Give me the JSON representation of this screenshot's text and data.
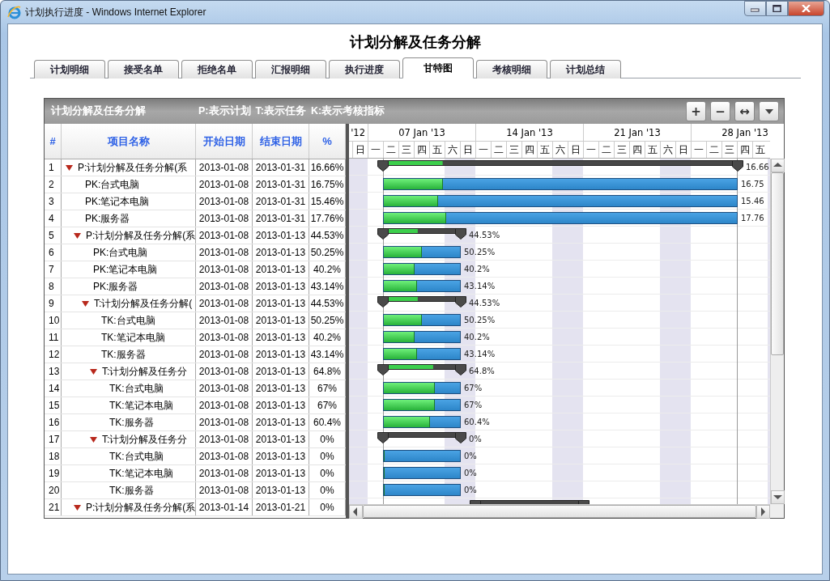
{
  "window": {
    "title": "计划执行进度 - Windows Internet Explorer"
  },
  "page_title": "计划分解及任务分解",
  "tabs": [
    {
      "label": "计划明细",
      "selected": false
    },
    {
      "label": "接受名单",
      "selected": false
    },
    {
      "label": "拒绝名单",
      "selected": false
    },
    {
      "label": "汇报明细",
      "selected": false
    },
    {
      "label": "执行进度",
      "selected": false
    },
    {
      "label": "甘特图",
      "selected": true
    },
    {
      "label": "考核明细",
      "selected": false
    },
    {
      "label": "计划总结",
      "selected": false
    }
  ],
  "panel": {
    "title": "计划分解及任务分解",
    "legend": [
      "P:表示计划",
      "T:表示任务",
      "K:表示考核指标"
    ],
    "toolbar_buttons": [
      "+",
      "−",
      "↔"
    ]
  },
  "columns": [
    "#",
    "项目名称",
    "开始日期",
    "结束日期",
    "%"
  ],
  "timeline": {
    "weeks": [
      "'12",
      "07 Jan '13",
      "14 Jan '13",
      "21 Jan '13",
      "28 Jan '13"
    ],
    "days": [
      "日",
      "一",
      "二",
      "三",
      "四",
      "五",
      "六",
      "日",
      "一",
      "二",
      "三",
      "四",
      "五",
      "六",
      "日",
      "一",
      "二",
      "三",
      "四",
      "五",
      "六",
      "日",
      "一",
      "二",
      "三",
      "四",
      "五"
    ]
  },
  "rows": [
    {
      "num": "1",
      "name": "P:计划分解及任务分解(系",
      "start": "2013-01-08",
      "end": "2013-01-31",
      "percent": "16.66%",
      "expanded": true,
      "bar": {
        "kind": "summary",
        "level": 0.1666,
        "label": "16.66"
      },
      "children": [
        {
          "num": "2",
          "name": "PK:台式电脑",
          "start": "2013-01-08",
          "end": "2013-01-31",
          "percent": "16.75%",
          "bar": {
            "kind": "task",
            "level": 0.1675,
            "label": "16.75"
          }
        },
        {
          "num": "3",
          "name": "PK:笔记本电脑",
          "start": "2013-01-08",
          "end": "2013-01-31",
          "percent": "15.46%",
          "bar": {
            "kind": "task",
            "level": 0.1546,
            "label": "15.46"
          }
        },
        {
          "num": "4",
          "name": "PK:服务器",
          "start": "2013-01-08",
          "end": "2013-01-31",
          "percent": "17.76%",
          "bar": {
            "kind": "task",
            "level": 0.1776,
            "label": "17.76"
          }
        },
        {
          "num": "5",
          "name": "P:计划分解及任务分解(系",
          "start": "2013-01-08",
          "end": "2013-01-13",
          "percent": "44.53%",
          "expanded": true,
          "bar": {
            "kind": "summary",
            "level": 0.4453,
            "label": "44.53%"
          },
          "children": [
            {
              "num": "6",
              "name": "PK:台式电脑",
              "start": "2013-01-08",
              "end": "2013-01-13",
              "percent": "50.25%",
              "bar": {
                "kind": "task",
                "level": 0.5025,
                "label": "50.25%"
              }
            },
            {
              "num": "7",
              "name": "PK:笔记本电脑",
              "start": "2013-01-08",
              "end": "2013-01-13",
              "percent": "40.2%",
              "bar": {
                "kind": "task",
                "level": 0.402,
                "label": "40.2%"
              }
            },
            {
              "num": "8",
              "name": "PK:服务器",
              "start": "2013-01-08",
              "end": "2013-01-13",
              "percent": "43.14%",
              "bar": {
                "kind": "task",
                "level": 0.4314,
                "label": "43.14%"
              }
            },
            {
              "num": "9",
              "name": "T:计划分解及任务分解(",
              "start": "2013-01-08",
              "end": "2013-01-13",
              "percent": "44.53%",
              "expanded": true,
              "bar": {
                "kind": "summary",
                "level": 0.4453,
                "label": "44.53%"
              },
              "children": [
                {
                  "num": "10",
                  "name": "TK:台式电脑",
                  "start": "2013-01-08",
                  "end": "2013-01-13",
                  "percent": "50.25%",
                  "bar": {
                    "kind": "task",
                    "level": 0.5025,
                    "label": "50.25%"
                  }
                },
                {
                  "num": "11",
                  "name": "TK:笔记本电脑",
                  "start": "2013-01-08",
                  "end": "2013-01-13",
                  "percent": "40.2%",
                  "bar": {
                    "kind": "task",
                    "level": 0.402,
                    "label": "40.2%"
                  }
                },
                {
                  "num": "12",
                  "name": "TK:服务器",
                  "start": "2013-01-08",
                  "end": "2013-01-13",
                  "percent": "43.14%",
                  "bar": {
                    "kind": "task",
                    "level": 0.4314,
                    "label": "43.14%"
                  }
                },
                {
                  "num": "13",
                  "name": "T:计划分解及任务分",
                  "start": "2013-01-08",
                  "end": "2013-01-13",
                  "percent": "64.8%",
                  "expanded": true,
                  "bar": {
                    "kind": "summary",
                    "level": 0.648,
                    "label": "64.8%"
                  },
                  "children": [
                    {
                      "num": "14",
                      "name": "TK:台式电脑",
                      "start": "2013-01-08",
                      "end": "2013-01-13",
                      "percent": "67%",
                      "bar": {
                        "kind": "task",
                        "level": 0.67,
                        "label": "67%"
                      }
                    },
                    {
                      "num": "15",
                      "name": "TK:笔记本电脑",
                      "start": "2013-01-08",
                      "end": "2013-01-13",
                      "percent": "67%",
                      "bar": {
                        "kind": "task",
                        "level": 0.67,
                        "label": "67%"
                      }
                    },
                    {
                      "num": "16",
                      "name": "TK:服务器",
                      "start": "2013-01-08",
                      "end": "2013-01-13",
                      "percent": "60.4%",
                      "bar": {
                        "kind": "task",
                        "level": 0.604,
                        "label": "60.4%"
                      }
                    }
                  ]
                },
                {
                  "num": "17",
                  "name": "T:计划分解及任务分",
                  "start": "2013-01-08",
                  "end": "2013-01-13",
                  "percent": "0%",
                  "expanded": true,
                  "bar": {
                    "kind": "summary",
                    "level": 0,
                    "label": "0%"
                  },
                  "children": [
                    {
                      "num": "18",
                      "name": "TK:台式电脑",
                      "start": "2013-01-08",
                      "end": "2013-01-13",
                      "percent": "0%",
                      "bar": {
                        "kind": "task",
                        "level": 0,
                        "label": "0%"
                      }
                    },
                    {
                      "num": "19",
                      "name": "TK:笔记本电脑",
                      "start": "2013-01-08",
                      "end": "2013-01-13",
                      "percent": "0%",
                      "bar": {
                        "kind": "task",
                        "level": 0,
                        "label": "0%"
                      }
                    },
                    {
                      "num": "20",
                      "name": "TK:服务器",
                      "start": "2013-01-08",
                      "end": "2013-01-13",
                      "percent": "0%",
                      "bar": {
                        "kind": "task",
                        "level": 0,
                        "label": "0%"
                      }
                    }
                  ]
                }
              ]
            }
          ]
        },
        {
          "num": "21",
          "name": "P:计划分解及任务分解(系",
          "start": "2013-01-14",
          "end": "2013-01-21",
          "percent": "0%",
          "expanded": true,
          "bar": {
            "kind": "summary",
            "level": 0
          }
        }
      ]
    }
  ]
}
